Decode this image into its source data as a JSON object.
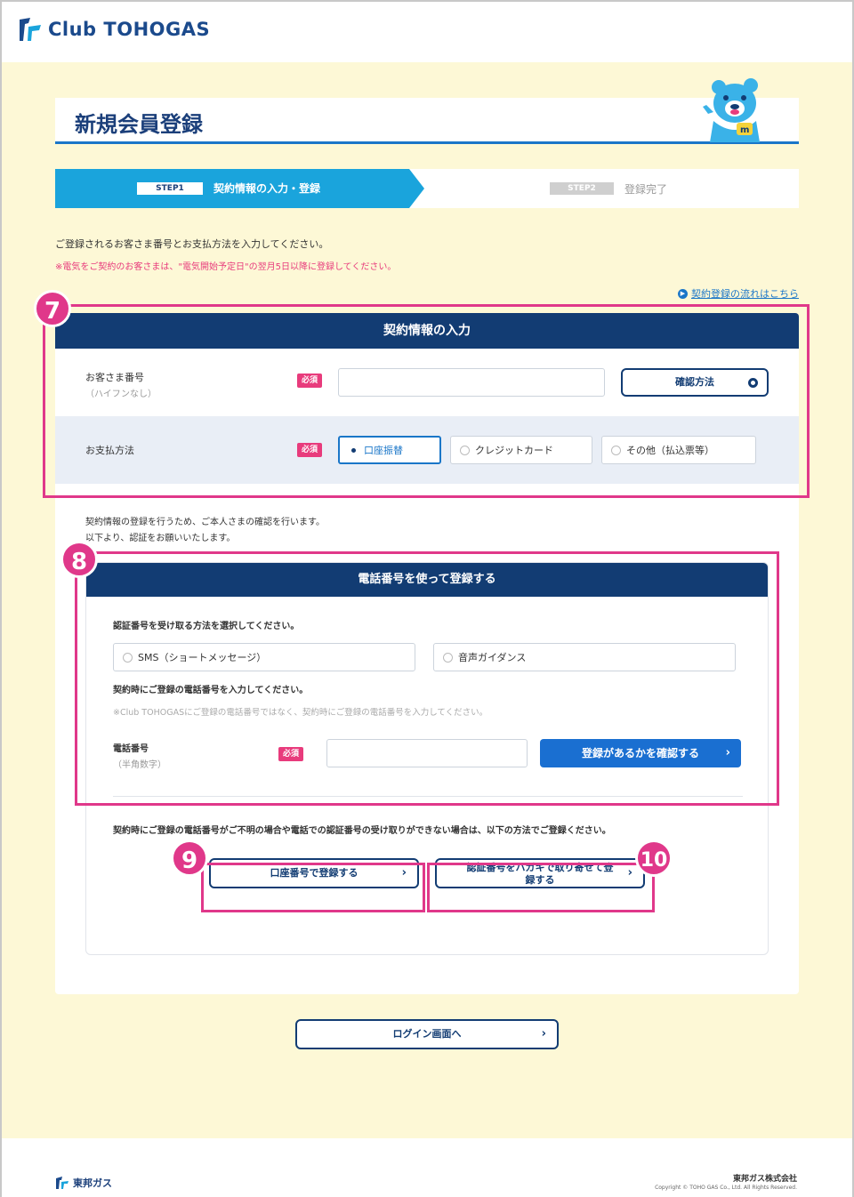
{
  "header": {
    "logo_text": "Club TOHOGAS"
  },
  "page": {
    "title": "新規会員登録"
  },
  "steps": [
    {
      "badge": "STEP1",
      "label": "契約情報の入力・登録",
      "active": true
    },
    {
      "badge": "STEP2",
      "label": "登録完了",
      "active": false
    }
  ],
  "intro": {
    "text": "ご登録されるお客さま番号とお支払方法を入力してください。",
    "warning": "※電気をご契約のお客さまは、\"電気開始予定日\"の翌月5日以降に登録してください。",
    "flow_link": "契約登録の流れはこちら"
  },
  "contract_panel": {
    "title": "契約情報の入力",
    "customer_number": {
      "label": "お客さま番号",
      "sub": "（ハイフンなし）",
      "required": "必須",
      "value": "",
      "check_button": "確認方法"
    },
    "payment": {
      "label": "お支払方法",
      "required": "必須",
      "options": [
        "口座振替",
        "クレジットカード",
        "その他（払込票等）"
      ],
      "selected": "口座振替"
    }
  },
  "auth_note": {
    "line1": "契約情報の登録を行うため、ご本人さまの確認を行います。",
    "line2": "以下より、認証をお願いいたします。"
  },
  "phone_panel": {
    "title": "電話番号を使って登録する",
    "method_prompt": "認証番号を受け取る方法を選択してください。",
    "methods": [
      "SMS（ショートメッセージ）",
      "音声ガイダンス"
    ],
    "phone_prompt": "契約時にご登録の電話番号を入力してください。",
    "phone_note": "※Club TOHOGASにご登録の電話番号ではなく、契約時にご登録の電話番号を入力してください。",
    "phone_label": "電話番号",
    "phone_sub": "（半角数字）",
    "required": "必須",
    "phone_value": "",
    "confirm_button": "登録があるかを確認する"
  },
  "alt": {
    "note": "契約時にご登録の電話番号がご不明の場合や電話での認証番号の受け取りができない場合は、以下の方法でご登録ください。",
    "bank_button": "口座番号で登録する",
    "postcard_button_l1": "認証番号をハガキで取り寄せて登",
    "postcard_button_l2": "録する"
  },
  "login_button": "ログイン画面へ",
  "annotations": [
    "7",
    "8",
    "9",
    "10"
  ],
  "footer": {
    "logo_text": "東邦ガス",
    "company": "東邦ガス株式会社",
    "copyright": "Copyright © TOHO GAS Co., Ltd. All Rights Reserved."
  },
  "colors": {
    "navy": "#123c73",
    "accent": "#1a76c8",
    "highlight": "#e0388a",
    "required": "#e83b7c",
    "page_bg": "#fdf8d6"
  }
}
